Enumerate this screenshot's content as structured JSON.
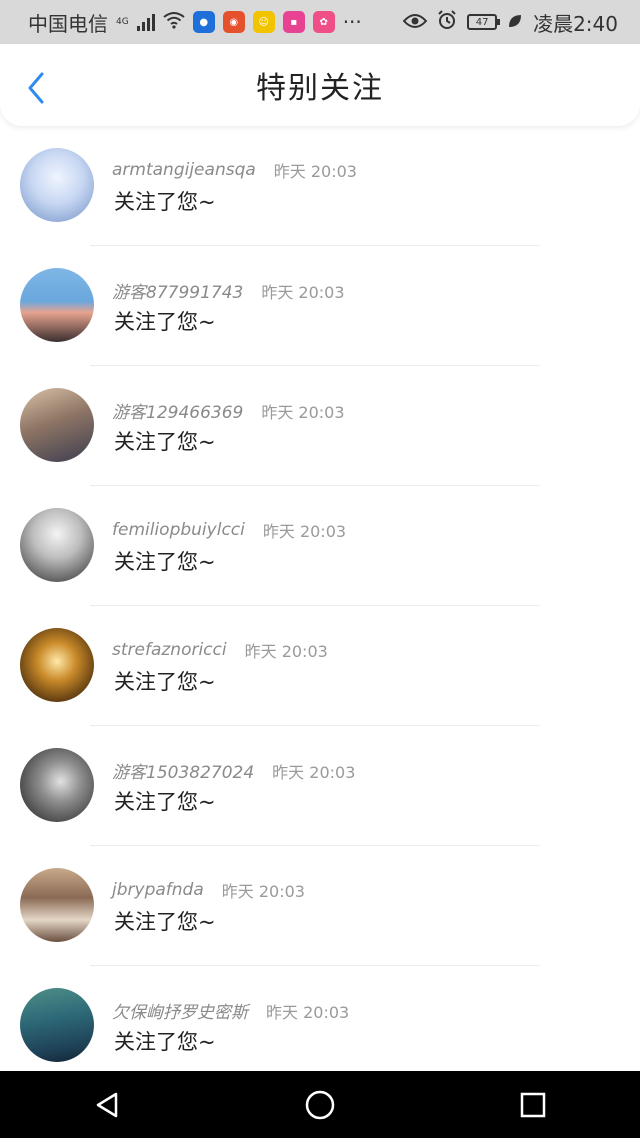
{
  "status_bar": {
    "carrier": "中国电信",
    "network": "4G",
    "time": "凌晨2:40",
    "battery": "47"
  },
  "header": {
    "title": "特别关注"
  },
  "follows": [
    {
      "name": "armtangijeansqa",
      "time": "昨天 20:03",
      "message": "关注了您~"
    },
    {
      "name": "游客877991743",
      "time": "昨天 20:03",
      "message": "关注了您~"
    },
    {
      "name": "游客129466369",
      "time": "昨天 20:03",
      "message": "关注了您~"
    },
    {
      "name": "femiliopbuiylcci",
      "time": "昨天 20:03",
      "message": "关注了您~"
    },
    {
      "name": "strefaznoricci",
      "time": "昨天 20:03",
      "message": "关注了您~"
    },
    {
      "name": "游客1503827024",
      "time": "昨天 20:03",
      "message": "关注了您~"
    },
    {
      "name": "jbrypafnda",
      "time": "昨天 20:03",
      "message": "关注了您~"
    },
    {
      "name": "欠保峋抒罗史密斯",
      "time": "昨天 20:03",
      "message": "关注了您~"
    }
  ],
  "colors": {
    "accent": "#2f8bf0",
    "status_bar_bg": "#d9d9d9",
    "nav_bar_bg": "#000000"
  },
  "icons": {
    "back": "chevron-left-icon",
    "nav_back": "triangle-back-icon",
    "nav_home": "circle-home-icon",
    "nav_recent": "square-recent-icon"
  }
}
